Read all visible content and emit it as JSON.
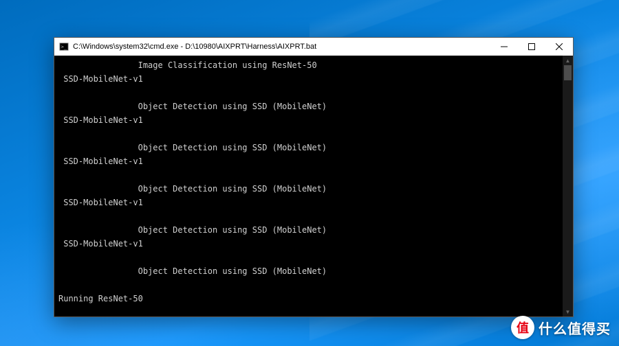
{
  "window": {
    "title": "C:\\Windows\\system32\\cmd.exe - D:\\10980\\AIXPRT\\Harness\\AIXPRT.bat"
  },
  "console": {
    "lines": [
      "                Image Classification using ResNet-50",
      " SSD-MobileNet-v1",
      "",
      "                Object Detection using SSD (MobileNet)",
      " SSD-MobileNet-v1",
      "",
      "                Object Detection using SSD (MobileNet)",
      " SSD-MobileNet-v1",
      "",
      "                Object Detection using SSD (MobileNet)",
      " SSD-MobileNet-v1",
      "",
      "                Object Detection using SSD (MobileNet)",
      " SSD-MobileNet-v1",
      "",
      "                Object Detection using SSD (MobileNet)",
      "",
      "Running ResNet-50"
    ]
  },
  "watermark": {
    "badge": "值",
    "text": "什么值得买"
  }
}
